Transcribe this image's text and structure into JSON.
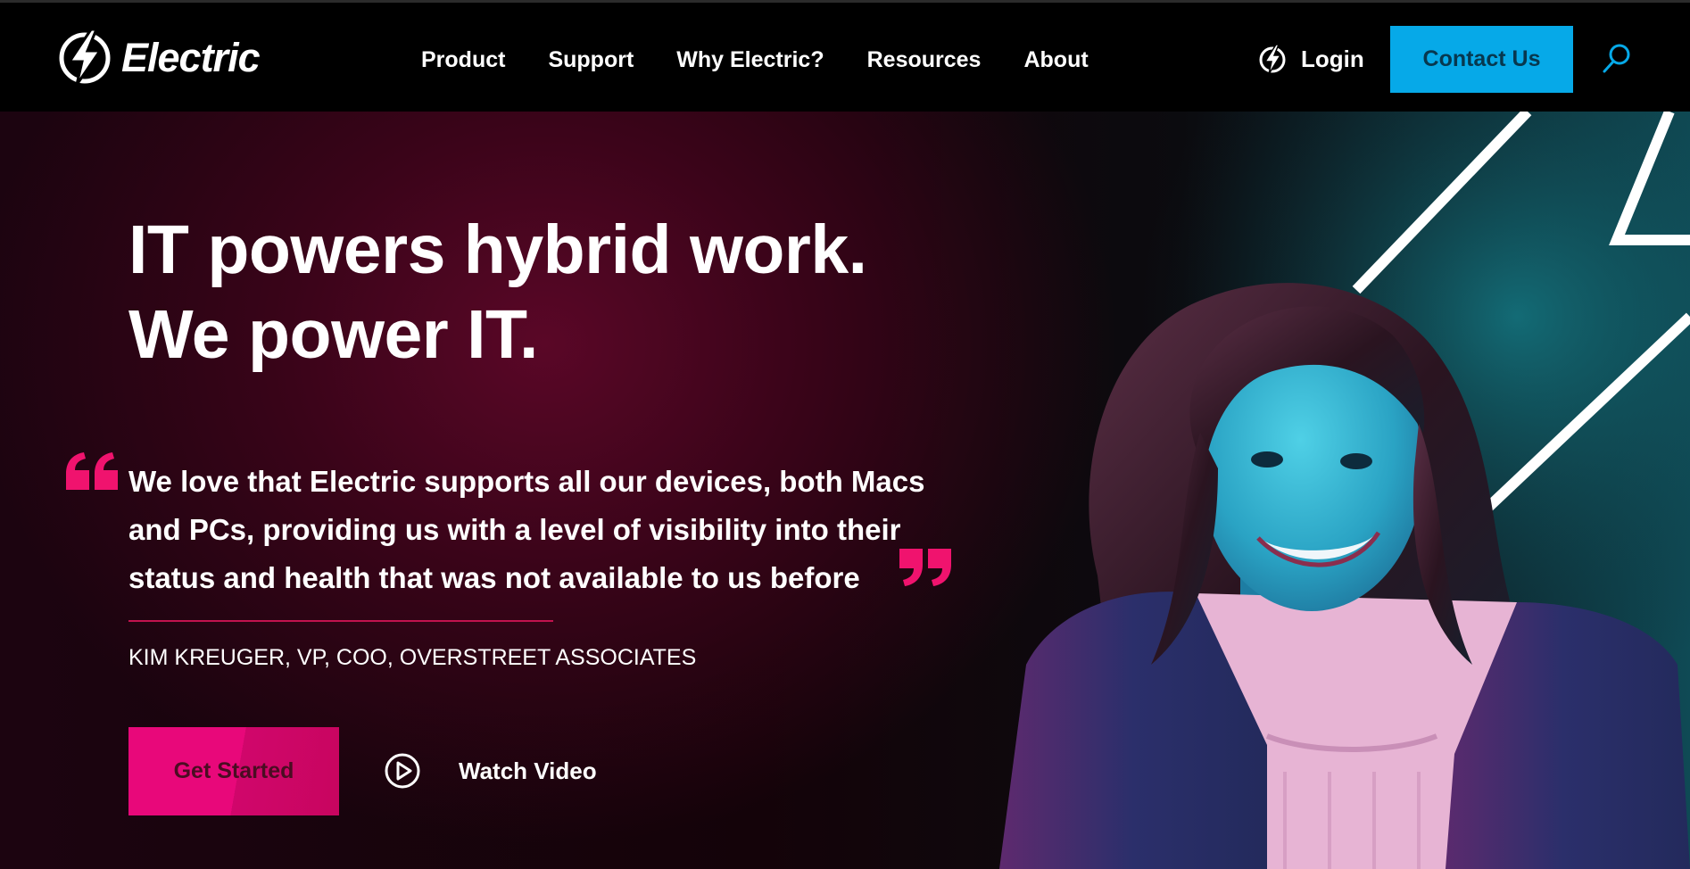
{
  "brand": {
    "name": "Electric"
  },
  "nav": {
    "items": [
      "Product",
      "Support",
      "Why Electric?",
      "Resources",
      "About"
    ],
    "login_label": "Login",
    "contact_label": "Contact Us"
  },
  "hero": {
    "headline_line1": "IT powers hybrid work.",
    "headline_line2": "We power IT.",
    "quote_lines": [
      "We love that Electric supports all our devices, both Macs",
      "and PCs, providing us with a level of visibility into their",
      "status and health that was not available to us before"
    ],
    "attribution": "KIM KREUGER, VP, COO, OVERSTREET ASSOCIATES",
    "cta_label": "Get Started",
    "video_label": "Watch Video"
  },
  "colors": {
    "accent_pink": "#e8087a",
    "accent_blue": "#06a9e8",
    "nav_bg": "#000000"
  },
  "icons": {
    "logo": "lightning-bolt-circle-icon",
    "login": "lightning-bolt-circle-icon",
    "search": "search-icon",
    "play": "play-circle-icon",
    "quote_open": "quote-open-icon",
    "quote_close": "quote-close-icon"
  }
}
